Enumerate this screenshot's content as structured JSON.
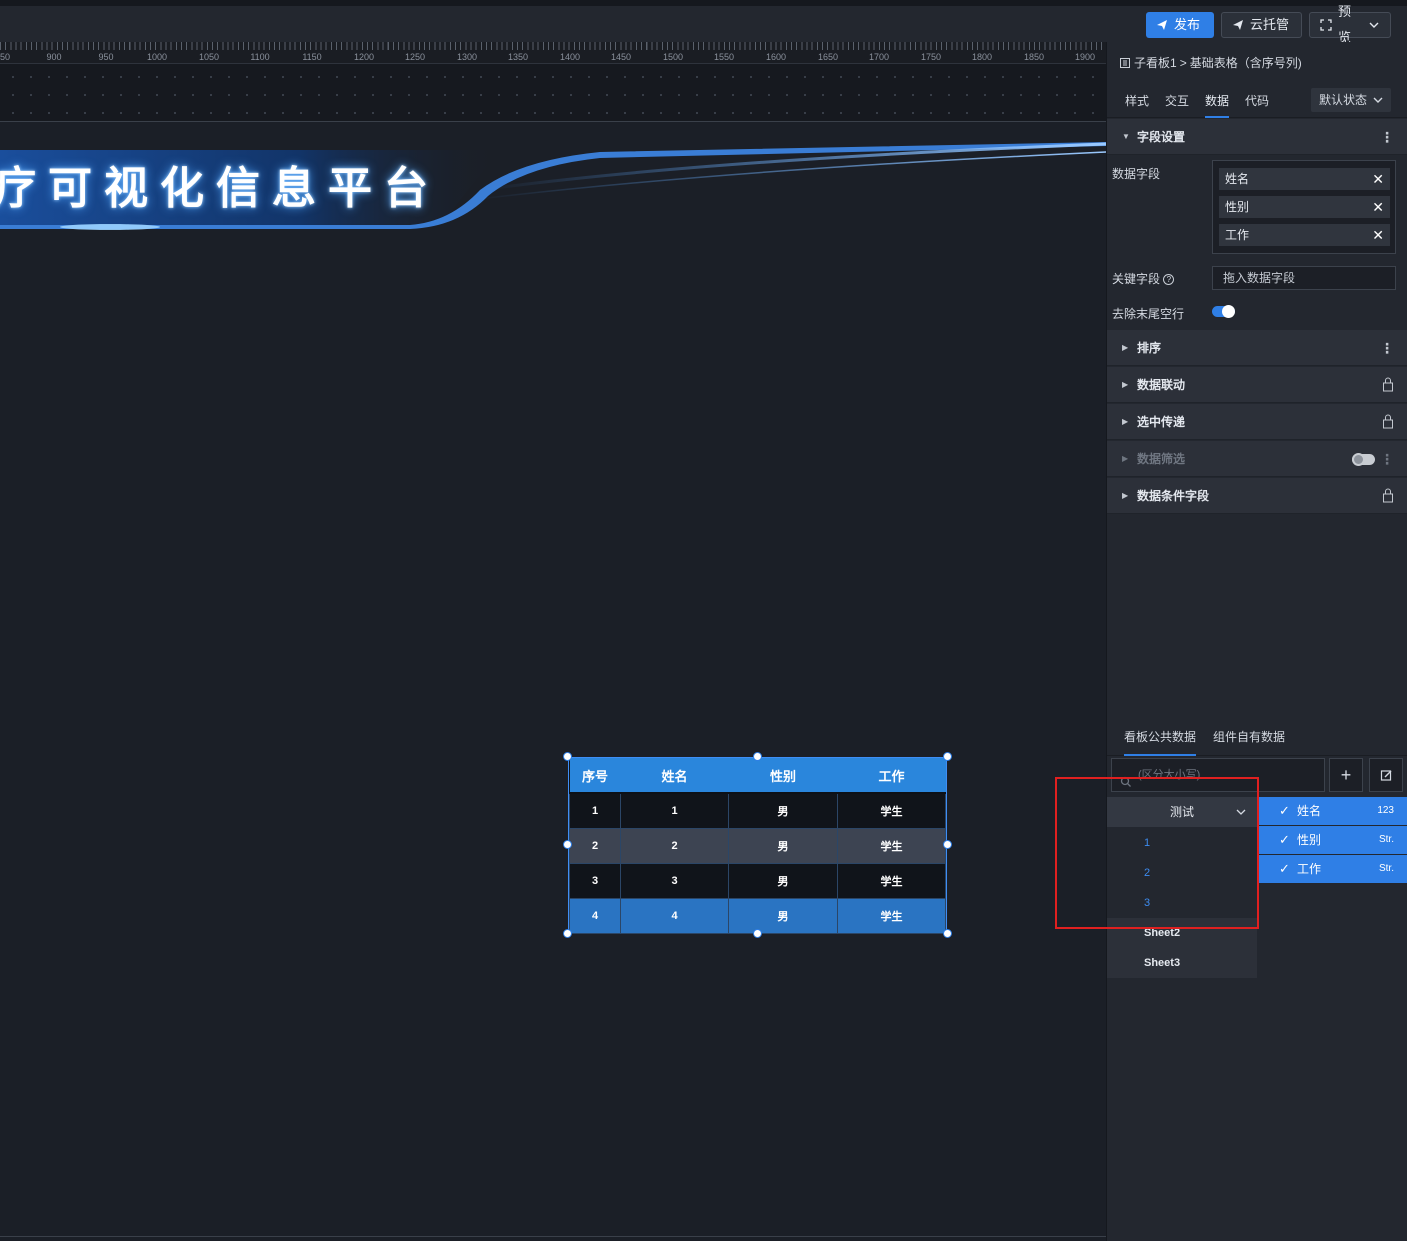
{
  "toolbar": {
    "publish": "发布",
    "cloud": "云托管",
    "preview": "预览"
  },
  "ruler": {
    "ticks": [
      "50",
      "900",
      "950",
      "1000",
      "1050",
      "1100",
      "1150",
      "1200",
      "1250",
      "1300",
      "1350",
      "1400",
      "1450",
      "1500",
      "1550",
      "1600",
      "1650",
      "1700",
      "1750",
      "1800",
      "1850",
      "1900"
    ]
  },
  "banner": {
    "title": "疗可视化信息平台"
  },
  "table": {
    "headers": [
      "序号",
      "姓名",
      "性别",
      "工作"
    ],
    "rows": [
      [
        "1",
        "1",
        "男",
        "学生"
      ],
      [
        "2",
        "2",
        "男",
        "学生"
      ],
      [
        "3",
        "3",
        "男",
        "学生"
      ],
      [
        "4",
        "4",
        "男",
        "学生"
      ]
    ]
  },
  "panel": {
    "breadcrumb": {
      "parent": "子看板1",
      "separator": ">",
      "current": "基础表格（含序号列)"
    },
    "tabs": [
      "样式",
      "交互",
      "数据",
      "代码"
    ],
    "active_tab": "数据",
    "state_select": "默认状态",
    "field_settings": {
      "title": "字段设置",
      "data_fields_label": "数据字段",
      "data_fields": [
        "姓名",
        "性别",
        "工作"
      ],
      "key_field_label": "关键字段",
      "key_field_placeholder": "拖入数据字段",
      "trim_empty_label": "去除末尾空行",
      "trim_empty_on": true
    },
    "sections": [
      {
        "title": "排序",
        "right": "more"
      },
      {
        "title": "数据联动",
        "right": "lock"
      },
      {
        "title": "选中传递",
        "right": "lock"
      },
      {
        "title": "数据筛选",
        "right": "toggle",
        "disabled": true
      },
      {
        "title": "数据条件字段",
        "right": "lock"
      }
    ],
    "data_source": {
      "tabs": [
        "看板公共数据",
        "组件自有数据"
      ],
      "active_tab": "看板公共数据",
      "search_placeholder": "(区分大小写)",
      "sheet_group": "测试",
      "sub_items": [
        "1",
        "2",
        "3"
      ],
      "sheets": [
        "Sheet2",
        "Sheet3"
      ],
      "columns": [
        {
          "name": "姓名",
          "type": "123"
        },
        {
          "name": "性别",
          "type": "Str."
        },
        {
          "name": "工作",
          "type": "Str."
        }
      ]
    }
  },
  "colors": {
    "accent": "#2f7fe6",
    "annotation": "#e02020"
  }
}
